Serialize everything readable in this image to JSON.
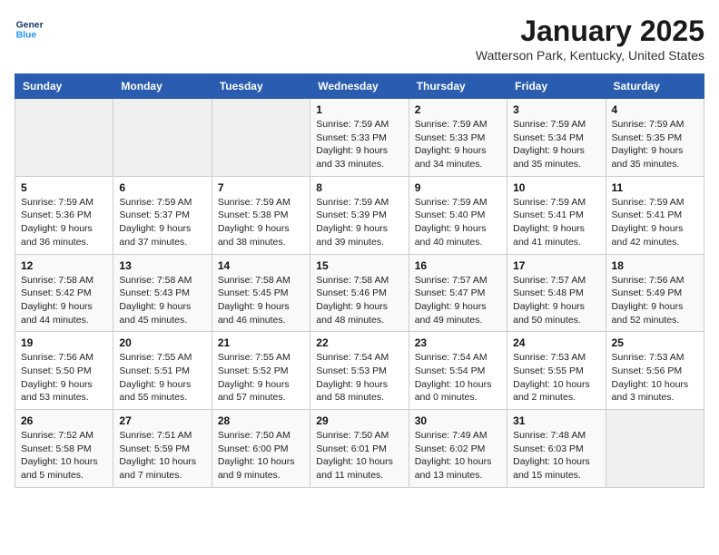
{
  "logo": {
    "line1": "General",
    "line2": "Blue"
  },
  "title": "January 2025",
  "subtitle": "Watterson Park, Kentucky, United States",
  "days_of_week": [
    "Sunday",
    "Monday",
    "Tuesday",
    "Wednesday",
    "Thursday",
    "Friday",
    "Saturday"
  ],
  "weeks": [
    [
      {
        "day": "",
        "info": ""
      },
      {
        "day": "",
        "info": ""
      },
      {
        "day": "",
        "info": ""
      },
      {
        "day": "1",
        "info": "Sunrise: 7:59 AM\nSunset: 5:33 PM\nDaylight: 9 hours\nand 33 minutes."
      },
      {
        "day": "2",
        "info": "Sunrise: 7:59 AM\nSunset: 5:33 PM\nDaylight: 9 hours\nand 34 minutes."
      },
      {
        "day": "3",
        "info": "Sunrise: 7:59 AM\nSunset: 5:34 PM\nDaylight: 9 hours\nand 35 minutes."
      },
      {
        "day": "4",
        "info": "Sunrise: 7:59 AM\nSunset: 5:35 PM\nDaylight: 9 hours\nand 35 minutes."
      }
    ],
    [
      {
        "day": "5",
        "info": "Sunrise: 7:59 AM\nSunset: 5:36 PM\nDaylight: 9 hours\nand 36 minutes."
      },
      {
        "day": "6",
        "info": "Sunrise: 7:59 AM\nSunset: 5:37 PM\nDaylight: 9 hours\nand 37 minutes."
      },
      {
        "day": "7",
        "info": "Sunrise: 7:59 AM\nSunset: 5:38 PM\nDaylight: 9 hours\nand 38 minutes."
      },
      {
        "day": "8",
        "info": "Sunrise: 7:59 AM\nSunset: 5:39 PM\nDaylight: 9 hours\nand 39 minutes."
      },
      {
        "day": "9",
        "info": "Sunrise: 7:59 AM\nSunset: 5:40 PM\nDaylight: 9 hours\nand 40 minutes."
      },
      {
        "day": "10",
        "info": "Sunrise: 7:59 AM\nSunset: 5:41 PM\nDaylight: 9 hours\nand 41 minutes."
      },
      {
        "day": "11",
        "info": "Sunrise: 7:59 AM\nSunset: 5:41 PM\nDaylight: 9 hours\nand 42 minutes."
      }
    ],
    [
      {
        "day": "12",
        "info": "Sunrise: 7:58 AM\nSunset: 5:42 PM\nDaylight: 9 hours\nand 44 minutes."
      },
      {
        "day": "13",
        "info": "Sunrise: 7:58 AM\nSunset: 5:43 PM\nDaylight: 9 hours\nand 45 minutes."
      },
      {
        "day": "14",
        "info": "Sunrise: 7:58 AM\nSunset: 5:45 PM\nDaylight: 9 hours\nand 46 minutes."
      },
      {
        "day": "15",
        "info": "Sunrise: 7:58 AM\nSunset: 5:46 PM\nDaylight: 9 hours\nand 48 minutes."
      },
      {
        "day": "16",
        "info": "Sunrise: 7:57 AM\nSunset: 5:47 PM\nDaylight: 9 hours\nand 49 minutes."
      },
      {
        "day": "17",
        "info": "Sunrise: 7:57 AM\nSunset: 5:48 PM\nDaylight: 9 hours\nand 50 minutes."
      },
      {
        "day": "18",
        "info": "Sunrise: 7:56 AM\nSunset: 5:49 PM\nDaylight: 9 hours\nand 52 minutes."
      }
    ],
    [
      {
        "day": "19",
        "info": "Sunrise: 7:56 AM\nSunset: 5:50 PM\nDaylight: 9 hours\nand 53 minutes."
      },
      {
        "day": "20",
        "info": "Sunrise: 7:55 AM\nSunset: 5:51 PM\nDaylight: 9 hours\nand 55 minutes."
      },
      {
        "day": "21",
        "info": "Sunrise: 7:55 AM\nSunset: 5:52 PM\nDaylight: 9 hours\nand 57 minutes."
      },
      {
        "day": "22",
        "info": "Sunrise: 7:54 AM\nSunset: 5:53 PM\nDaylight: 9 hours\nand 58 minutes."
      },
      {
        "day": "23",
        "info": "Sunrise: 7:54 AM\nSunset: 5:54 PM\nDaylight: 10 hours\nand 0 minutes."
      },
      {
        "day": "24",
        "info": "Sunrise: 7:53 AM\nSunset: 5:55 PM\nDaylight: 10 hours\nand 2 minutes."
      },
      {
        "day": "25",
        "info": "Sunrise: 7:53 AM\nSunset: 5:56 PM\nDaylight: 10 hours\nand 3 minutes."
      }
    ],
    [
      {
        "day": "26",
        "info": "Sunrise: 7:52 AM\nSunset: 5:58 PM\nDaylight: 10 hours\nand 5 minutes."
      },
      {
        "day": "27",
        "info": "Sunrise: 7:51 AM\nSunset: 5:59 PM\nDaylight: 10 hours\nand 7 minutes."
      },
      {
        "day": "28",
        "info": "Sunrise: 7:50 AM\nSunset: 6:00 PM\nDaylight: 10 hours\nand 9 minutes."
      },
      {
        "day": "29",
        "info": "Sunrise: 7:50 AM\nSunset: 6:01 PM\nDaylight: 10 hours\nand 11 minutes."
      },
      {
        "day": "30",
        "info": "Sunrise: 7:49 AM\nSunset: 6:02 PM\nDaylight: 10 hours\nand 13 minutes."
      },
      {
        "day": "31",
        "info": "Sunrise: 7:48 AM\nSunset: 6:03 PM\nDaylight: 10 hours\nand 15 minutes."
      },
      {
        "day": "",
        "info": ""
      }
    ]
  ]
}
